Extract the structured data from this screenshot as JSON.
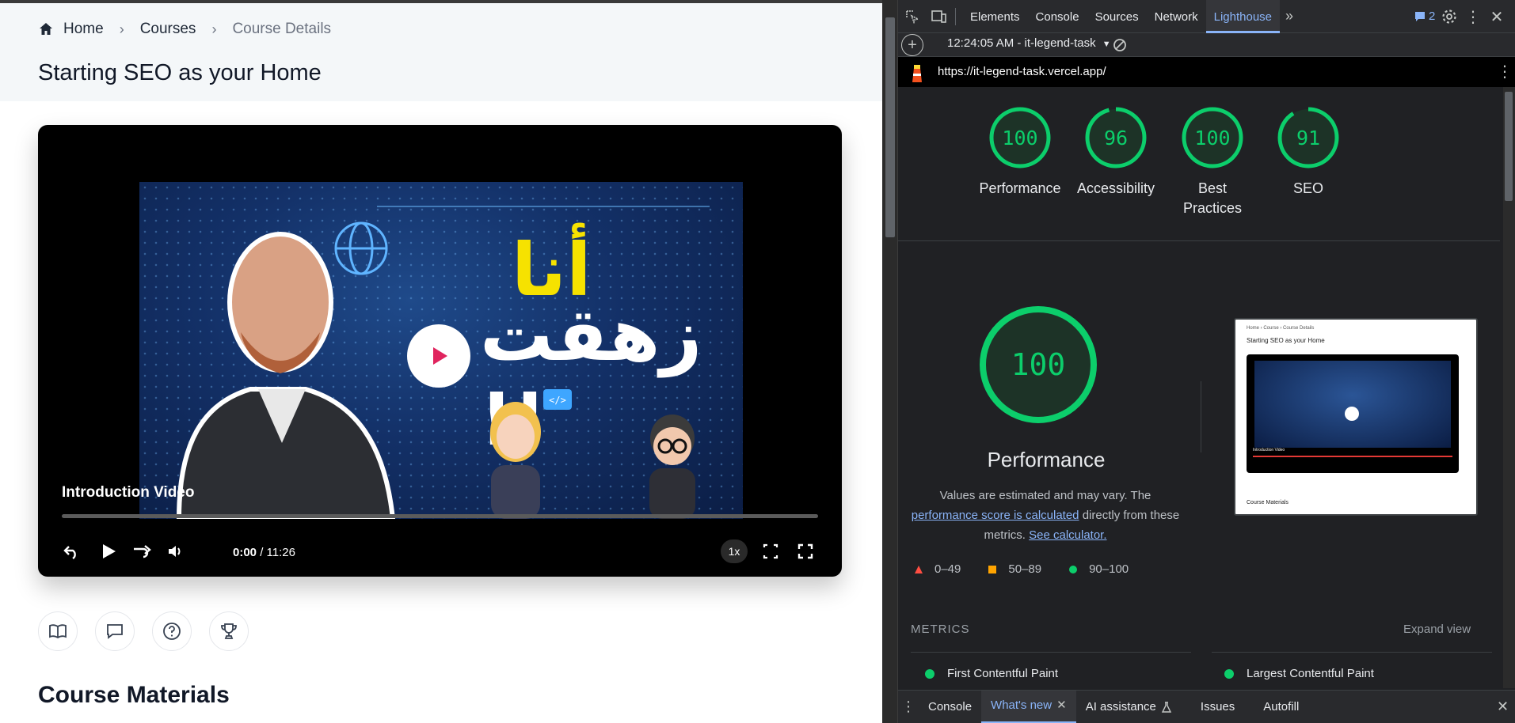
{
  "page": {
    "breadcrumb": [
      "Home",
      "Courses",
      "Course Details"
    ],
    "title": "Starting SEO as your Home",
    "video": {
      "caption": "Introduction Video",
      "thumbnail_text_line1": "أنا",
      "thumbnail_text_line2": "زهقت !!",
      "time_current": "0:00",
      "time_total": "/ 11:26",
      "speed": "1x",
      "progress_fraction": 0.0
    },
    "materials_title": "Course Materials"
  },
  "devtools": {
    "tabs": [
      "Elements",
      "Console",
      "Sources",
      "Network",
      "Lighthouse"
    ],
    "active_tab": "Lighthouse",
    "issues_count": "2",
    "report_time": "12:24:05 AM - it-legend-task",
    "url": "https://it-legend-task.vercel.app/",
    "gauges": [
      {
        "score": "100",
        "label": "Performance",
        "value": 100
      },
      {
        "score": "96",
        "label": "Accessibility",
        "value": 96
      },
      {
        "score": "100",
        "label": "Best Practices",
        "value": 100
      },
      {
        "score": "91",
        "label": "SEO",
        "value": 91
      }
    ],
    "performance": {
      "score": "100",
      "heading": "Performance",
      "desc_part1": "Values are estimated and may vary. The",
      "desc_link1": "performance score is calculated",
      "desc_part2": "directly from these metrics.",
      "desc_link2": "See calculator."
    },
    "legend": [
      {
        "range": "0–49",
        "color": "#ff4e42"
      },
      {
        "range": "50–89",
        "color": "#ffa400"
      },
      {
        "range": "90–100",
        "color": "#0cce6b"
      }
    ],
    "screenshot": {
      "breadcrumb": "Home  ›  Course  ›  Course Details",
      "title": "Starting SEO as your Home",
      "caption": "Introduction Video",
      "footer": "Course Materials"
    },
    "metrics_heading": "METRICS",
    "expand_view": "Expand view",
    "metrics": [
      "First Contentful Paint",
      "Largest Contentful Paint"
    ],
    "drawer_tabs": [
      "Console",
      "What's new",
      "AI assistance",
      "Issues",
      "Autofill"
    ],
    "drawer_active": "What's new",
    "colors": {
      "pass": "#0cce6b",
      "link": "#8ab4f8",
      "bg": "#202124"
    }
  }
}
